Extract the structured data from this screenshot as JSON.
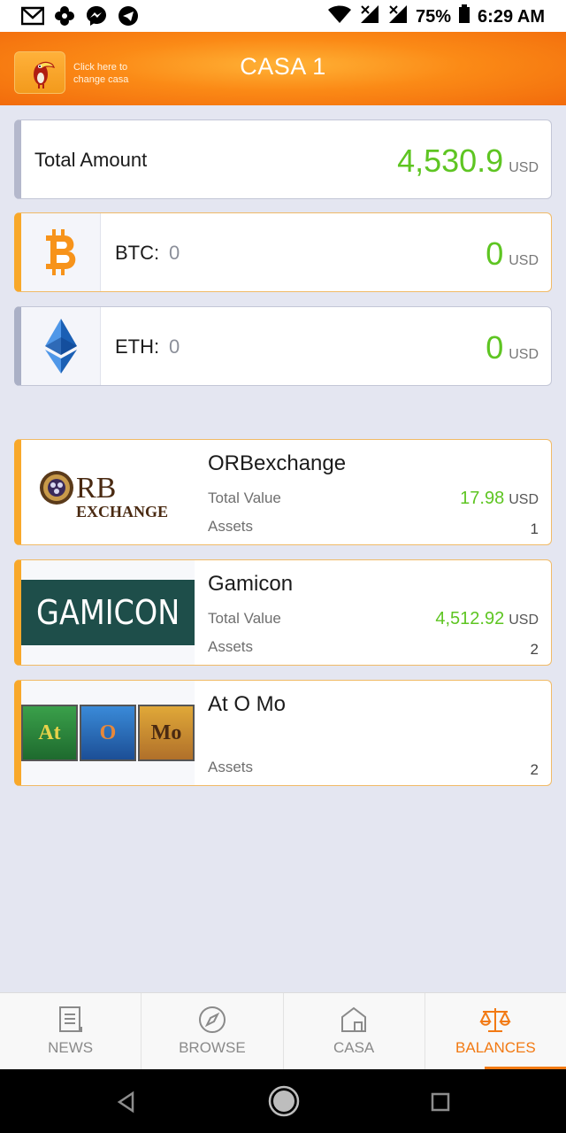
{
  "status_bar": {
    "battery": "75%",
    "time": "6:29 AM",
    "left_icons": [
      "gmail-icon",
      "pinwheel-icon",
      "messenger-icon",
      "telegram-icon"
    ],
    "right_icons": [
      "wifi-icon",
      "signal-icon",
      "signal-icon",
      "battery-icon"
    ]
  },
  "header": {
    "hint": "Click here to change casa",
    "title": "CASA 1"
  },
  "total": {
    "label": "Total Amount",
    "value": "4,530.9",
    "currency": "USD"
  },
  "coins": [
    {
      "label": "BTC:",
      "amount": "0",
      "value": "0",
      "currency": "USD",
      "icon": "bitcoin-icon"
    },
    {
      "label": "ETH:",
      "amount": "0",
      "value": "0",
      "currency": "USD",
      "icon": "ethereum-icon"
    }
  ],
  "exchanges": [
    {
      "name": "ORBexchange",
      "logo_text": [
        "RB",
        "EXCHANGE"
      ],
      "total_value_label": "Total Value",
      "total_value": "17.98",
      "currency": "USD",
      "assets_label": "Assets",
      "assets": "1"
    },
    {
      "name": "Gamicon",
      "logo_text": "GAMICON",
      "total_value_label": "Total Value",
      "total_value": "4,512.92",
      "currency": "USD",
      "assets_label": "Assets",
      "assets": "2"
    },
    {
      "name": "At O Mo",
      "logo_text": [
        "At",
        "O",
        "Mo"
      ],
      "assets_label": "Assets",
      "assets": "2"
    }
  ],
  "bottom_nav": [
    {
      "label": "NEWS",
      "icon": "news-icon"
    },
    {
      "label": "BROWSE",
      "icon": "compass-icon"
    },
    {
      "label": "CASA",
      "icon": "house-icon"
    },
    {
      "label": "BALANCES",
      "icon": "scales-icon",
      "active": true
    }
  ],
  "colors": {
    "accent": "#f27a14",
    "value_green": "#5ec522",
    "card_border_orange": "#f8a82a",
    "background": "#e4e6f1"
  }
}
